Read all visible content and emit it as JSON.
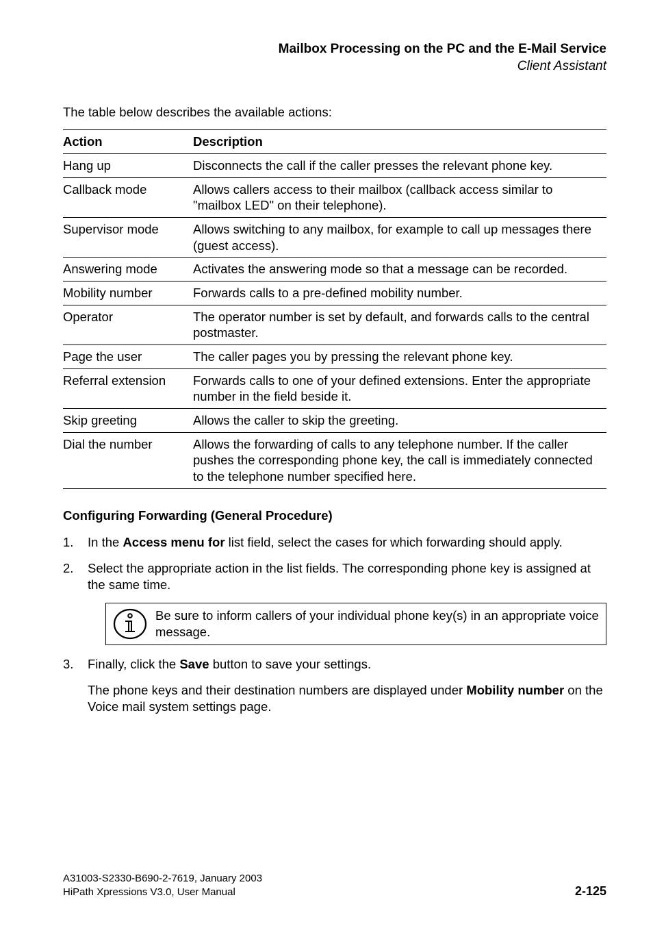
{
  "header": {
    "title": "Mailbox Processing on the PC and the E-Mail Service",
    "subtitle": "Client Assistant"
  },
  "intro": "The table below describes the available actions:",
  "table": {
    "headers": [
      "Action",
      "Description"
    ],
    "rows": [
      {
        "action": "Hang up",
        "description": "Disconnects the call if the caller presses the relevant phone key."
      },
      {
        "action": "Callback mode",
        "description": "Allows callers access to their mailbox (callback access similar to \"mailbox LED\" on their telephone)."
      },
      {
        "action": "Supervisor mode",
        "description": "Allows switching to any mailbox, for example to call up messages there (guest access)."
      },
      {
        "action": "Answering mode",
        "description": "Activates the answering mode so that a message can be recorded."
      },
      {
        "action": "Mobility number",
        "description": "Forwards calls to a pre-defined mobility number."
      },
      {
        "action": "Operator",
        "description": "The operator number is set by default, and forwards calls to the central postmaster."
      },
      {
        "action": "Page the user",
        "description": "The caller pages you by pressing the relevant phone key."
      },
      {
        "action": "Referral extension",
        "description": "Forwards calls to one of your defined extensions. Enter the appropriate number in the field beside it."
      },
      {
        "action": "Skip greeting",
        "description": "Allows the caller to skip the greeting."
      },
      {
        "action": "Dial the number",
        "description": "Allows the forwarding of calls to any telephone number. If the caller pushes the corresponding phone key, the call is immediately connected to the telephone number specified here."
      }
    ]
  },
  "section_heading": "Configuring Forwarding (General Procedure)",
  "steps": {
    "s1_prefix": "In the ",
    "s1_bold": "Access menu for",
    "s1_suffix": " list field, select the cases for which forwarding should apply.",
    "s2": "Select the appropriate action in the list fields. The corresponding phone key is assigned at the same time.",
    "tip": "Be sure to inform callers of your individual phone key(s) in an appropriate voice message.",
    "s3_prefix": "Finally, click the ",
    "s3_bold": "Save",
    "s3_suffix": " button to save your settings.",
    "s3_note_prefix": "The phone keys and their destination numbers are displayed under ",
    "s3_note_bold": "Mobility number",
    "s3_note_suffix": " on the Voice mail system settings page."
  },
  "step_numbers": {
    "n1": "1.",
    "n2": "2.",
    "n3": "3."
  },
  "footer": {
    "line1": "A31003-S2330-B690-2-7619, January 2003",
    "line2": "HiPath Xpressions V3.0, User Manual",
    "page": "2-125"
  }
}
